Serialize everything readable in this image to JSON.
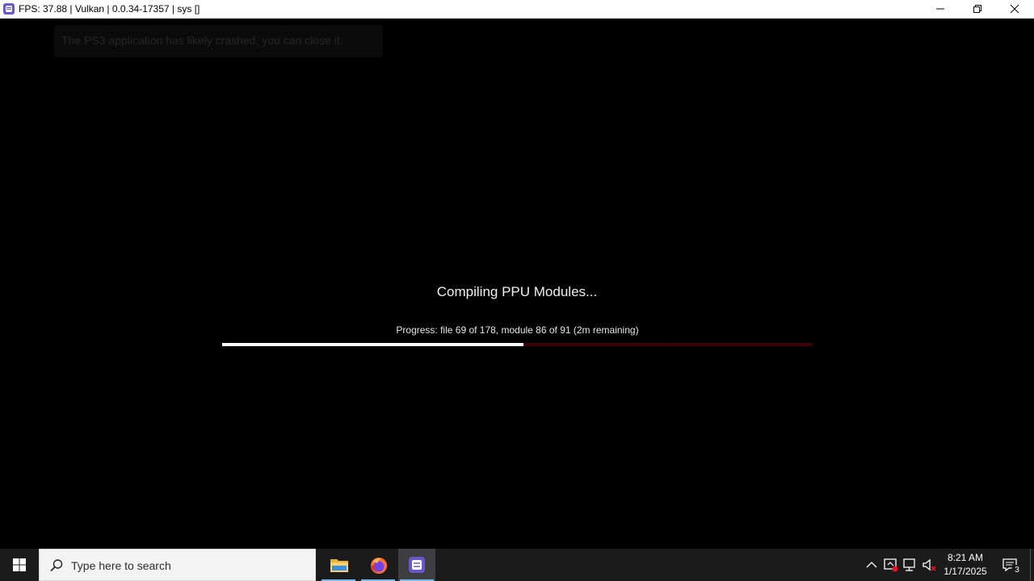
{
  "window": {
    "title": "FPS: 37.88 | Vulkan | 0.0.34-17357 | sys []",
    "icon": "rpcs3-app-icon",
    "controls": [
      "minimize-icon",
      "maximize-icon",
      "close-icon"
    ]
  },
  "game": {
    "crash_notice": "The PS3 application has likely crashed, you can close it.",
    "compile_title": "Compiling PPU Modules...",
    "progress_text": "Progress: file 69 of 178, module 86 of 91 (2m remaining)",
    "progress_fraction": 0.51,
    "colors": {
      "background": "#000000",
      "progress_fill": "#ffffff",
      "progress_track": "#3a0005"
    }
  },
  "taskbar": {
    "search_placeholder": "Type here to search",
    "apps": [
      {
        "name": "File Explorer",
        "icon": "folder-icon",
        "running": true,
        "active": false
      },
      {
        "name": "Firefox",
        "icon": "firefox-icon",
        "running": true,
        "active": false
      },
      {
        "name": "RPCS3",
        "icon": "rpcs3-icon",
        "running": true,
        "active": true
      }
    ],
    "tray_icons": [
      "chevron-up-icon",
      "security-icon",
      "network-icon",
      "volume-muted-icon"
    ],
    "clock": {
      "time": "8:21 AM",
      "date": "1/17/2025"
    },
    "notification_count": "3"
  }
}
